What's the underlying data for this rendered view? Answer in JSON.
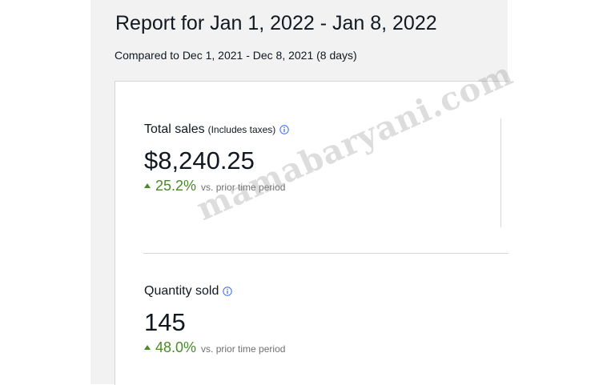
{
  "report": {
    "title": "Report for Jan 1, 2022 - Jan 8, 2022",
    "subtitle": "Compared to Dec 1, 2021 - Dec 8, 2021 (8 days)"
  },
  "metrics": [
    {
      "label": "Total sales",
      "note": "(Includes taxes)",
      "info_icon": "info-circle-icon",
      "value": "$8,240.25",
      "change_direction": "up",
      "change": "25.2%",
      "change_note": "vs. prior time period"
    },
    {
      "label": "Quantity sold",
      "info_icon": "info-circle-icon",
      "value": "145",
      "change_direction": "up",
      "change": "48.0%",
      "change_note": "vs. prior time period"
    }
  ],
  "watermark": "mamabaryani.com",
  "colors": {
    "positive_change": "#4a8a2a",
    "info_icon": "#3665f3",
    "panel_background": "#f2f2f2"
  }
}
